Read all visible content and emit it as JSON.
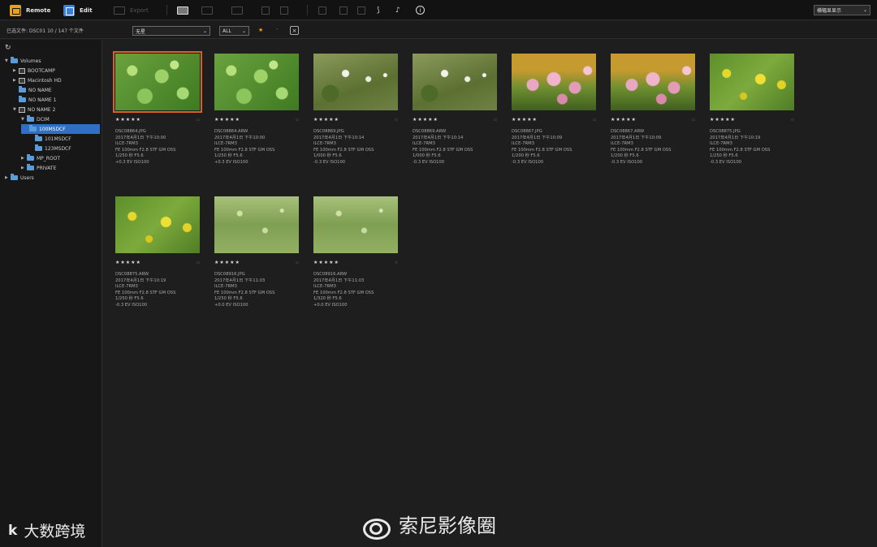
{
  "toolbar": {
    "remote_label": "Remote",
    "edit_label": "Edit",
    "export_label": "Export",
    "view_select": "横幅显显示"
  },
  "filterbar": {
    "status": "已选文件: DSC01  10 / 147 个文件",
    "filter1": "无星",
    "filter2": "ALL",
    "star": "★",
    "dash": "-",
    "clear": "×"
  },
  "sidebar": {
    "refresh_icon": "↻",
    "items": [
      {
        "label": "Volumes"
      },
      {
        "label": "BOOTCAMP"
      },
      {
        "label": "Macintosh HD"
      },
      {
        "label": "NO NAME"
      },
      {
        "label": "NO NAME 1"
      },
      {
        "label": "NO NAME 2"
      },
      {
        "label": "DCIM"
      },
      {
        "label": "100MSDCF"
      },
      {
        "label": "101MSDCF"
      },
      {
        "label": "123MSDCF"
      },
      {
        "label": "MP_ROOT"
      },
      {
        "label": "PRIVATE"
      },
      {
        "label": "Users"
      }
    ]
  },
  "thumbnails": [
    {
      "stars": "★★★★★",
      "file": "DSC08864.JPG",
      "date": "2017年4月1日 下午10:00",
      "model": "ILCE-7RM3",
      "lens": "FE 100mm F2.8 STF GM OSS",
      "exposure": "1/250 秒 F5.6",
      "ev": "+0.3 EV ISO100",
      "color": "green"
    },
    {
      "stars": "★★★★★",
      "file": "DSC08864.ARW",
      "date": "2017年4月1日 下午10:00",
      "model": "ILCE-7RM3",
      "lens": "FE 100mm F2.8 STF GM OSS",
      "exposure": "1/250 秒 F5.6",
      "ev": "+0.3 EV ISO100",
      "color": "green"
    },
    {
      "stars": "★★★★★",
      "file": "DSC08869.JPG",
      "date": "2017年4月1日 下午10:14",
      "model": "ILCE-7RM3",
      "lens": "FE 100mm F2.8 STF GM OSS",
      "exposure": "1/000 秒 F5.6",
      "ev": "-0.3 EV ISO100",
      "color": "white"
    },
    {
      "stars": "★★★★★",
      "file": "DSC08869.ARW",
      "date": "2017年4月1日 下午10:14",
      "model": "ILCE-7RM3",
      "lens": "FE 100mm F2.8 STF GM OSS",
      "exposure": "1/000 秒 F5.6",
      "ev": "-0.3 EV ISO100",
      "color": "white"
    },
    {
      "stars": "★★★★★",
      "file": "DSC08867.JPG",
      "date": "2017年4月1日 下午10:09",
      "model": "ILCE-7RM3",
      "lens": "FE 100mm F2.8 STF GM OSS",
      "exposure": "1/200 秒 F5.6",
      "ev": "-0.3 EV ISO100",
      "color": "pink"
    },
    {
      "stars": "★★★★★",
      "file": "DSC08867.ARW",
      "date": "2017年4月1日 下午10:09",
      "model": "ILCE-7RM3",
      "lens": "FE 100mm F2.8 STF GM OSS",
      "exposure": "1/200 秒 F5.6",
      "ev": "-0.3 EV ISO100",
      "color": "pink"
    },
    {
      "stars": "★★★★★",
      "file": "DSC08875.JPG",
      "date": "2017年4月1日 下午10:19",
      "model": "ILCE-7RM3",
      "lens": "FE 100mm F2.8 STF GM OSS",
      "exposure": "1/250 秒 F5.6",
      "ev": "-0.3 EV ISO100",
      "color": "yellow"
    },
    {
      "stars": "★★★★★",
      "file": "DSC08875.ARW",
      "date": "2017年4月1日 下午10:19",
      "model": "ILCE-7RM3",
      "lens": "FE 100mm F2.8 STF GM OSS",
      "exposure": "1/250 秒 F5.6",
      "ev": "-0.3 EV ISO100",
      "color": "yellow"
    },
    {
      "stars": "★★★★★",
      "file": "DSC08916.JPG",
      "date": "2017年4月1日 下午11:03",
      "model": "ILCE-7RM3",
      "lens": "FE 100mm F2.8 STF GM OSS",
      "exposure": "1/250 秒 F5.6",
      "ev": "+0.0 EV ISO100",
      "color": "meadow"
    },
    {
      "stars": "★★★★★",
      "file": "DSC08916.ARW",
      "date": "2017年4月1日 下午11:03",
      "model": "ILCE-7RM3",
      "lens": "FE 100mm F2.8 STF GM OSS",
      "exposure": "1/320 秒 F5.6",
      "ev": "+0.0 EV ISO100",
      "color": "meadow"
    }
  ],
  "watermark": {
    "left": "大数跨境",
    "left_logo": "k",
    "right": "索尼影像圈"
  }
}
